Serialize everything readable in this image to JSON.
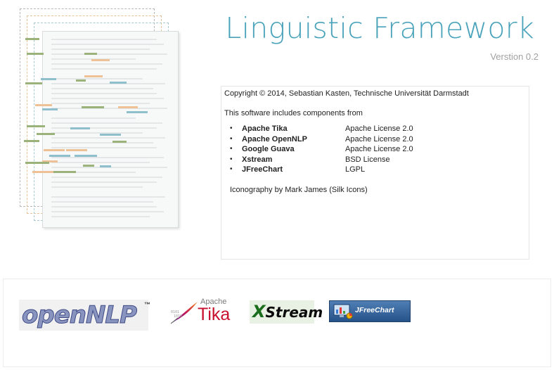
{
  "header": {
    "title": "Linguistic Framework",
    "version": "Verstion 0.2"
  },
  "about": {
    "copyright": "Copyright © 2014, Sebastian Kasten, Technische Universität Darmstadt",
    "includes_text": "This software includes components from",
    "bullet": "•",
    "components": [
      {
        "name": "Apache Tika",
        "license": "Apache License 2.0"
      },
      {
        "name": "Apache OpenNLP",
        "license": "Apache License 2.0"
      },
      {
        "name": "Google Guava",
        "license": "Apache License 2.0"
      },
      {
        "name": "Xstream",
        "license": "BSD License"
      },
      {
        "name": "JFreeChart",
        "license": "LGPL"
      }
    ],
    "iconography": "Iconography by Mark James (Silk Icons)"
  },
  "logos": {
    "opennlp": {
      "text": "openNLP",
      "tm": "™"
    },
    "tika": {
      "small": "Apache",
      "text": "Tika"
    },
    "xstream": {
      "x": "X",
      "rest": "Stream"
    },
    "jfreechart": {
      "text": "JFreeChart"
    }
  },
  "colors": {
    "title": "#4aa3bb",
    "highlight_green": "#9bb37a",
    "highlight_orange": "#efc196",
    "highlight_blue": "#8fbfcc"
  }
}
